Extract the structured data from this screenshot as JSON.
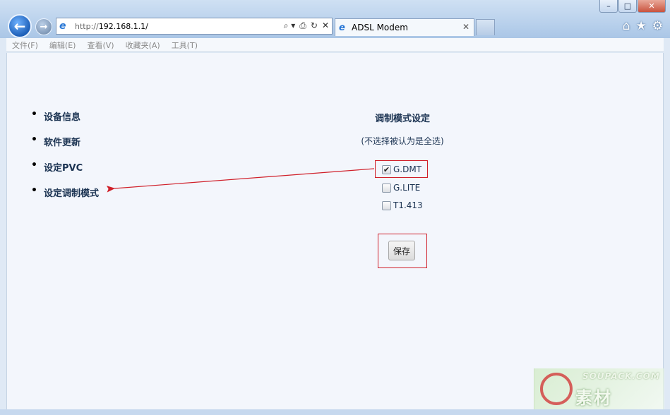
{
  "browser": {
    "window_buttons": [
      "–",
      "□",
      "✕"
    ],
    "address_url_proto": "http://",
    "address_url_host": "192.168.1.1/",
    "address_tools": [
      "⌕ ▾",
      "⎙",
      "↻",
      "✕"
    ],
    "tab_title": "ADSL Modem",
    "tab_close": "✕",
    "icons": [
      "home-icon",
      "star-icon",
      "gear-icon"
    ]
  },
  "menu": {
    "items": [
      "文件(F)",
      "编辑(E)",
      "查看(V)",
      "收藏夹(A)",
      "工具(T)"
    ]
  },
  "sidebar": {
    "items": [
      {
        "label": "设备信息"
      },
      {
        "label": "软件更新"
      },
      {
        "label": "设定PVC"
      },
      {
        "label": "设定调制模式"
      }
    ]
  },
  "modulation": {
    "title": "调制模式设定",
    "hint": "(不选择被认为是全选)",
    "options": [
      {
        "label": "G.DMT",
        "checked": true
      },
      {
        "label": "G.LITE",
        "checked": false
      },
      {
        "label": "T1.413",
        "checked": false
      }
    ],
    "save_label": "保存"
  },
  "watermark": {
    "line1": "SOUPACK.COM",
    "line2": "素材"
  },
  "colors": {
    "annotation": "#d0202a"
  }
}
